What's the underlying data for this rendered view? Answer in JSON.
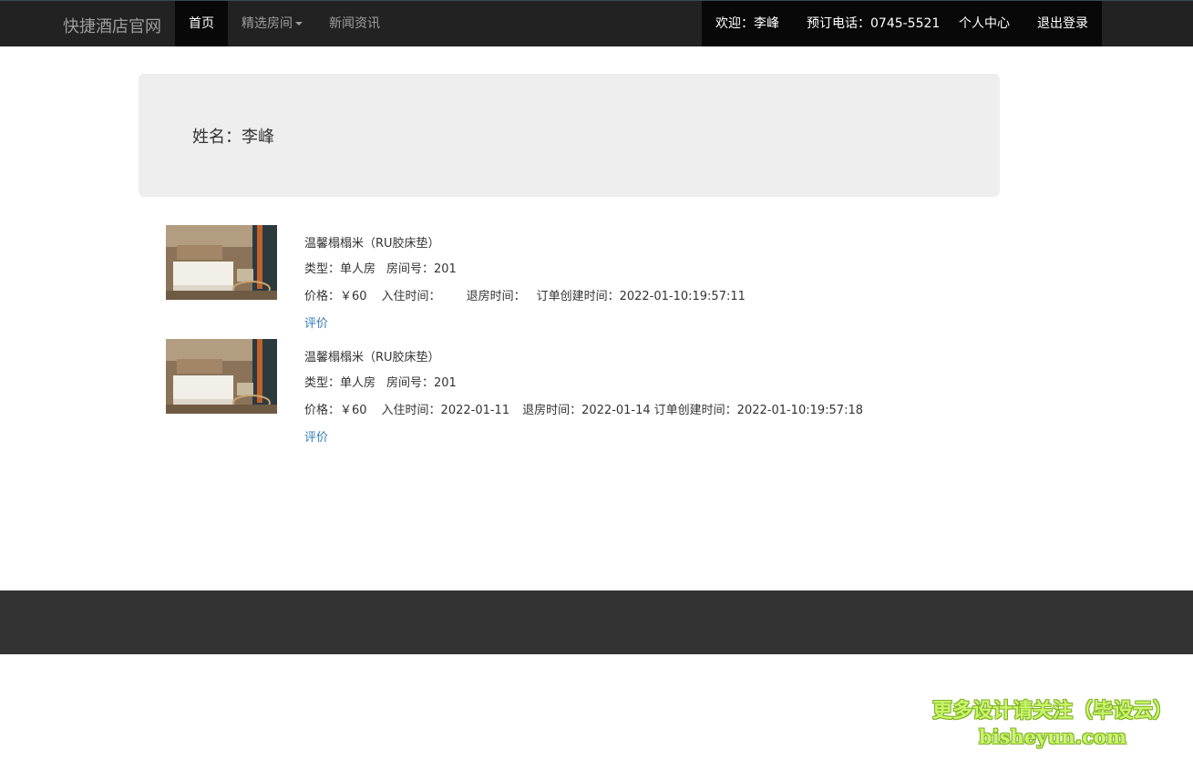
{
  "navbar": {
    "brand": "快捷酒店官网",
    "items": [
      {
        "label": "首页"
      },
      {
        "label": "精选房间"
      },
      {
        "label": "新闻资讯"
      }
    ],
    "right": {
      "welcome": "欢迎：李峰",
      "phone": "预订电话：0745-5521",
      "profile": "个人中心",
      "logout": "退出登录"
    }
  },
  "profile": {
    "name_text": "姓名：李峰"
  },
  "orders": [
    {
      "title": "温馨榻榻米（RU胶床垫）",
      "type_label": "类型：单人房",
      "room_label": "房间号：201",
      "price_label": "价格：￥60",
      "checkin_label": "入住时间：",
      "checkout_label": "退房时间：",
      "created_label": "订单创建时间：2022-01-10:19:57:11",
      "review_label": "评价"
    },
    {
      "title": "温馨榻榻米（RU胶床垫）",
      "type_label": "类型：单人房",
      "room_label": "房间号：201",
      "price_label": "价格：￥60",
      "checkin_label": "入住时间：2022-01-11",
      "checkout_label": "退房时间：2022-01-14",
      "created_label": "订单创建时间：2022-01-10:19:57:18",
      "review_label": "评价"
    }
  ],
  "watermark": {
    "line1": "更多设计请关注（毕设云）",
    "line2": "bisheyun.com"
  },
  "colors": {
    "navbar_bg": "#222222",
    "navbar_active": "#080808",
    "link": "#337ab7",
    "jumbotron_bg": "#eeeeee",
    "footer_bg": "#333333"
  }
}
